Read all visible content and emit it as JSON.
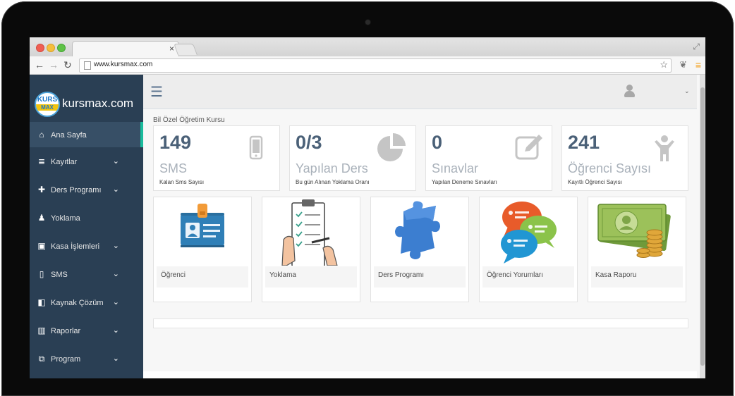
{
  "browser": {
    "tab_close": "×",
    "url": "www.kursmax.com",
    "icons": {
      "back": "arrow-left-icon",
      "forward": "arrow-right-icon",
      "reload": "reload-icon",
      "bookmark": "star-icon",
      "extension": "leaf-icon",
      "menu": "hamburger-icon",
      "fullscreen": "expand-icon"
    }
  },
  "brand": {
    "logo_top": "KURS",
    "logo_bottom": "MAX",
    "name": "kursmax.com"
  },
  "sidebar": {
    "items": [
      {
        "label": "Ana Sayfa",
        "icon": "home-icon",
        "active": true
      },
      {
        "label": "Kayıtlar",
        "icon": "database-icon",
        "chevron": true
      },
      {
        "label": "Ders Programı",
        "icon": "puzzle-icon",
        "chevron": true
      },
      {
        "label": "Yoklama",
        "icon": "person-icon",
        "chevron": false
      },
      {
        "label": "Kasa İşlemleri",
        "icon": "money-icon",
        "chevron": true
      },
      {
        "label": "SMS",
        "icon": "mobile-icon",
        "chevron": true
      },
      {
        "label": "Kaynak Çözüm",
        "icon": "book-icon",
        "chevron": true
      },
      {
        "label": "Raporlar",
        "icon": "bar-chart-icon",
        "chevron": true
      },
      {
        "label": "Program",
        "icon": "copy-icon",
        "chevron": true
      }
    ]
  },
  "header": {
    "org_name": "Bil         Özel Öğretim Kursu"
  },
  "stats": [
    {
      "value": "149",
      "label": "SMS",
      "desc": "Kalan Sms Sayısı",
      "icon": "mobile-icon"
    },
    {
      "value": "0/3",
      "label": "Yapılan Ders",
      "desc": "Bu gün Alınan Yoklama Oranı",
      "icon": "pie-chart-icon"
    },
    {
      "value": "0",
      "label": "Sınavlar",
      "desc": "Yapılan Deneme Sınavları",
      "icon": "edit-icon"
    },
    {
      "value": "241",
      "label": "Öğrenci Sayısı",
      "desc": "Kayıtlı Öğrenci Sayısı",
      "icon": "child-icon"
    }
  ],
  "tiles": [
    {
      "caption": "Öğrenci",
      "icon": "id-badge-icon"
    },
    {
      "caption": "Yoklama",
      "icon": "clipboard-checklist-icon"
    },
    {
      "caption": "Ders Programı",
      "icon": "puzzle-piece-icon"
    },
    {
      "caption": "Öğrenci Yorumları",
      "icon": "chat-bubbles-icon"
    },
    {
      "caption": "Kasa Raporu",
      "icon": "money-stack-icon"
    }
  ],
  "colors": {
    "sidebar_bg": "#2a3f54",
    "active_accent": "#1abb9c",
    "stat_value": "#4b6178"
  }
}
